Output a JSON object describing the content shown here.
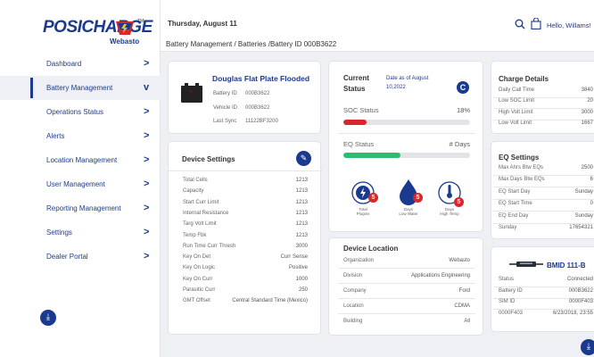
{
  "brand": {
    "name": "POSICHARGE",
    "sub": "Webasto",
    "tm": "TM"
  },
  "header": {
    "date": "Thursday, August 11",
    "breadcrumb": "Battery Management / Batteries /Battery ID 000B3622",
    "greeting": "Hello, Willams!"
  },
  "sidebar": {
    "items": [
      {
        "label": "Dashboard",
        "chevron": ">"
      },
      {
        "label": "Battery Management",
        "chevron": "v"
      },
      {
        "label": "Operations Status",
        "chevron": ">"
      },
      {
        "label": "Alerts",
        "chevron": ">"
      },
      {
        "label": "Location Management",
        "chevron": ">"
      },
      {
        "label": "User Management",
        "chevron": ">"
      },
      {
        "label": "Reporting Management",
        "chevron": ">"
      },
      {
        "label": "Settings",
        "chevron": ">"
      },
      {
        "label": "Dealer Portal",
        "chevron": ">"
      }
    ]
  },
  "battery": {
    "title": "Douglas Flat Plate Flooded",
    "rows": [
      {
        "label": "Battery ID",
        "value": "000B3622"
      },
      {
        "label": "Vehicle ID",
        "value": "000B3622"
      },
      {
        "label": "Last Sync",
        "value": "11122BF3200"
      }
    ]
  },
  "status": {
    "title_line1": "Current",
    "title_line2": "Status",
    "date_line1": "Date as of August",
    "date_line2": "10,2022",
    "soc_label": "SOC Status",
    "soc_value": "18%",
    "soc_fraction": 0.18,
    "eq_label": "EQ Status",
    "eq_value": "# Days",
    "eq_fraction": 0.45,
    "soc_color": "#d8262a",
    "eq_color": "#2dbd6e",
    "gauges": [
      {
        "icon": "plug-gauge-icon",
        "badge": "5",
        "label1": "Total",
        "label2": "Plugins"
      },
      {
        "icon": "water-drop-icon",
        "badge": "5",
        "label1": "Days",
        "label2": "Low Water"
      },
      {
        "icon": "thermometer-icon",
        "badge": "5",
        "label1": "Days",
        "label2": "High Temp"
      }
    ]
  },
  "device_settings": {
    "title": "Device Settings",
    "rows": [
      {
        "label": "Total Cells",
        "value": "1213"
      },
      {
        "label": "Capacity",
        "value": "1213"
      },
      {
        "label": "Start Curr Limit",
        "value": "1213"
      },
      {
        "label": "Internal Resistance",
        "value": "1213"
      },
      {
        "label": "Targ Volt Limit",
        "value": "1213"
      },
      {
        "label": "Temp Fbk",
        "value": "1213"
      },
      {
        "label": "Run Time Curr Thresh",
        "value": "3000"
      },
      {
        "label": "Key On Det",
        "value": "Curr Sense"
      },
      {
        "label": "Key On Logic",
        "value": "Positive"
      },
      {
        "label": "Key On Curr",
        "value": "1000"
      },
      {
        "label": "Parasitic Curr",
        "value": "250"
      },
      {
        "label": "GMT Offset",
        "value": "Central Standard Time (Mexico)"
      }
    ]
  },
  "location": {
    "title": "Device Location",
    "rows": [
      {
        "label": "Organization",
        "value": "Webasto"
      },
      {
        "label": "Division",
        "value": "Applications Engineering"
      },
      {
        "label": "Company",
        "value": "Ford"
      },
      {
        "label": "Location",
        "value": "CDMA"
      },
      {
        "label": "Building",
        "value": "All"
      }
    ]
  },
  "charge": {
    "title": "Charge Details",
    "rows": [
      {
        "label": "Daily Call Time",
        "value": "3840"
      },
      {
        "label": "Low SOC Limit",
        "value": "20"
      },
      {
        "label": "High Volt Limit",
        "value": "3000"
      },
      {
        "label": "Low Volt Limit",
        "value": "1667"
      }
    ]
  },
  "eq_settings": {
    "title": "EQ Settings",
    "rows": [
      {
        "label": "Max Ahrs Btw EQs",
        "value": "2500"
      },
      {
        "label": "Max Days Btw EQs",
        "value": "6"
      },
      {
        "label": "EQ Start Day",
        "value": "Sunday"
      },
      {
        "label": "EQ Start Time",
        "value": "0"
      },
      {
        "label": "EQ End Day",
        "value": "Sunday"
      },
      {
        "label": "Sunday",
        "value": "17654321"
      }
    ]
  },
  "bmid": {
    "title": "BMID 111-B",
    "rows": [
      {
        "label": "Status",
        "value": "Connected"
      },
      {
        "label": "Battery ID",
        "value": "000B3622"
      },
      {
        "label": "SIM ID",
        "value": "0000F403"
      },
      {
        "label": "0000F403",
        "value": "6/23/2018, 23:55"
      }
    ]
  }
}
